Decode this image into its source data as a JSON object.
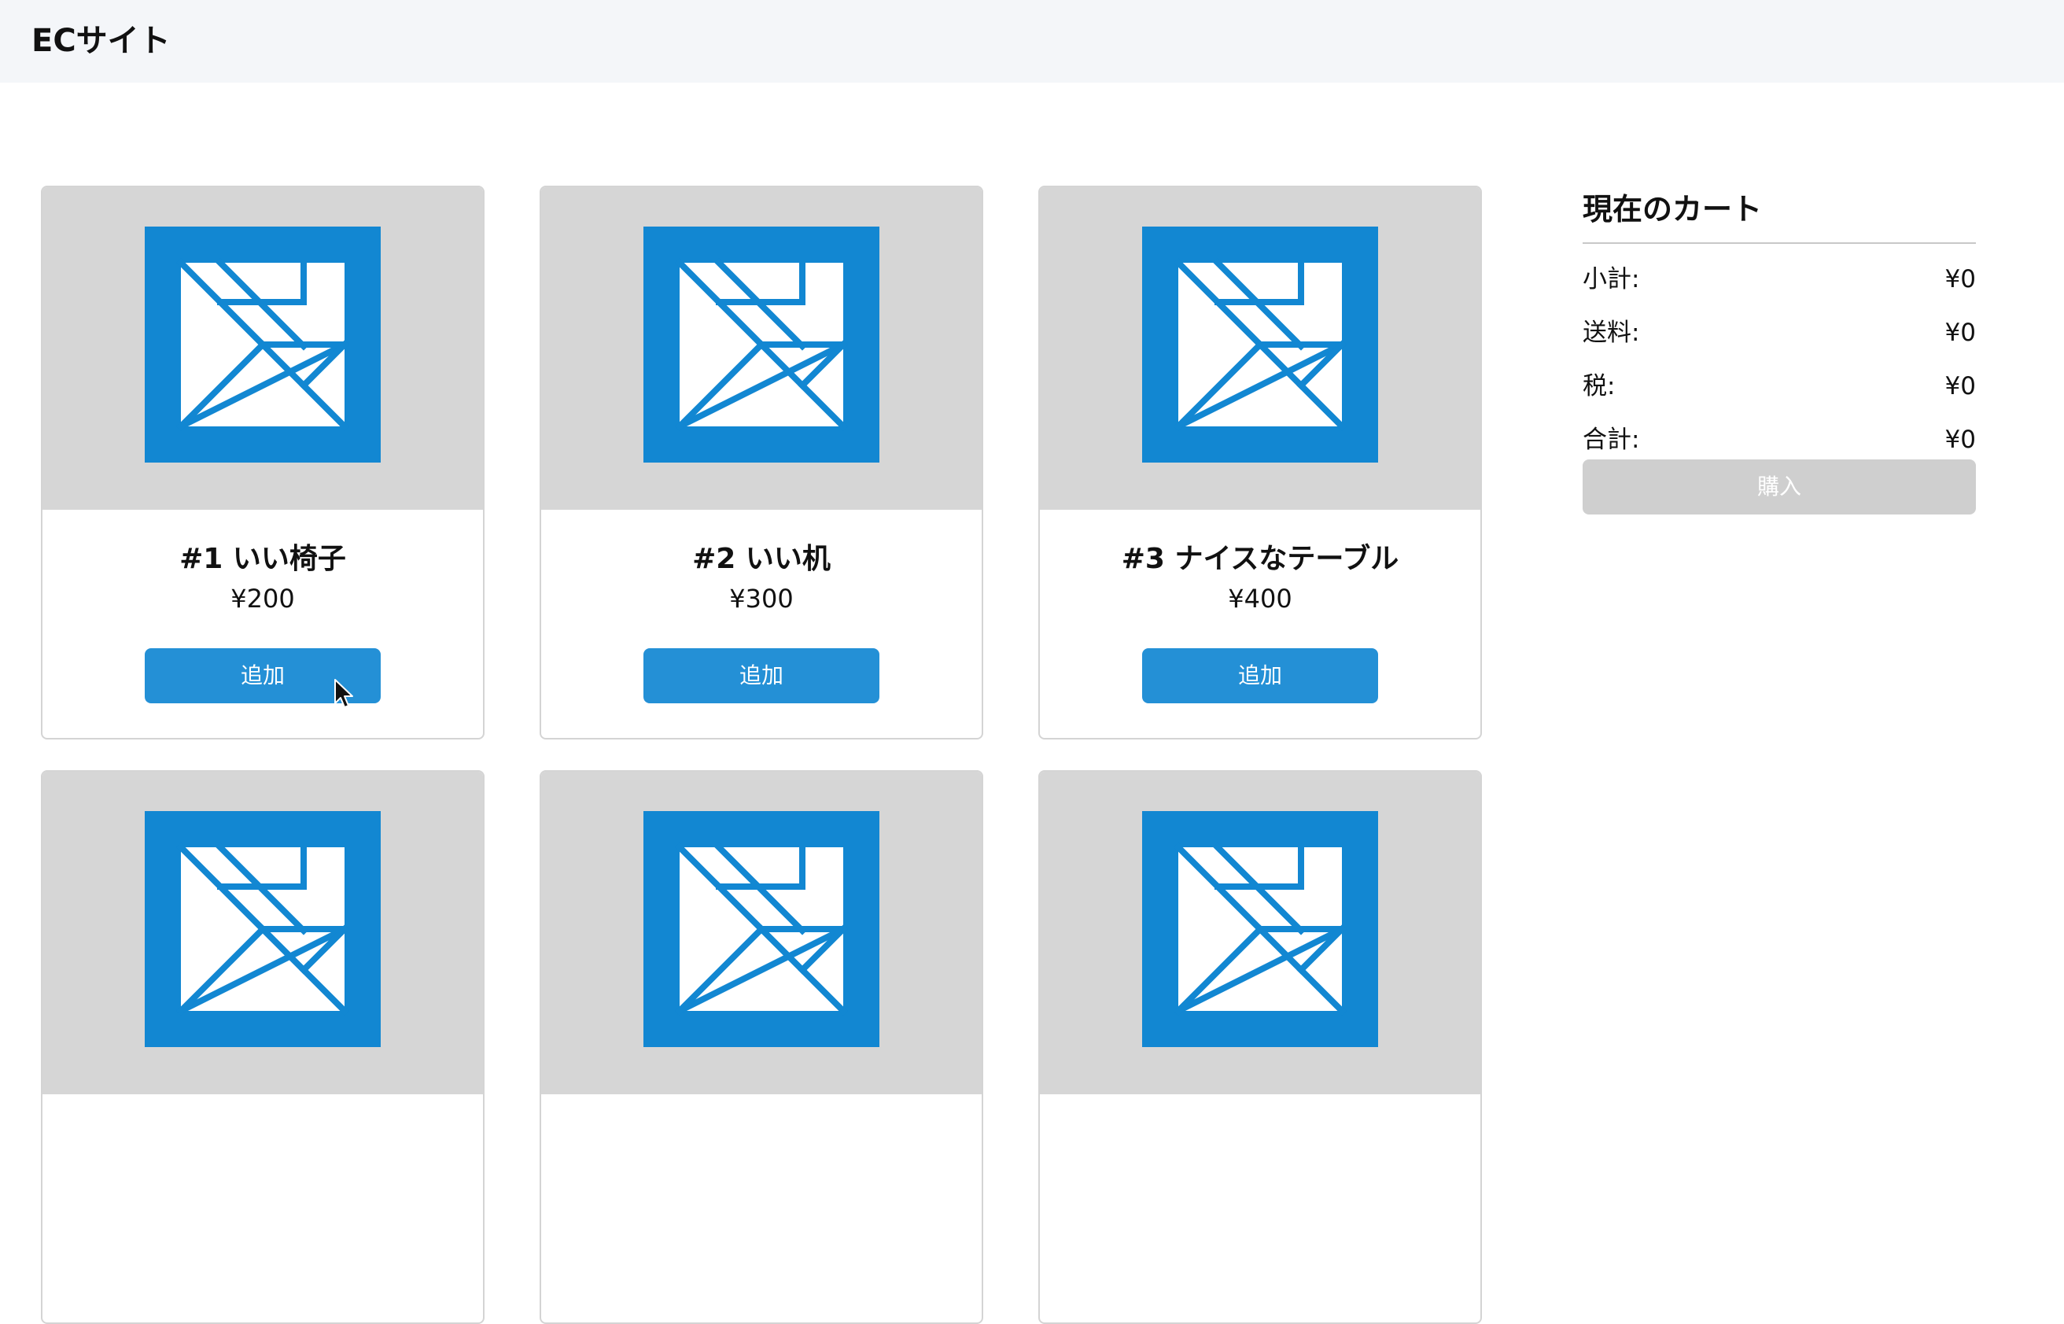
{
  "header": {
    "title": "ECサイト"
  },
  "products": [
    {
      "name": "#1 いい椅子",
      "price": "¥200",
      "add_label": "追加"
    },
    {
      "name": "#2 いい机",
      "price": "¥300",
      "add_label": "追加"
    },
    {
      "name": "#3 ナイスなテーブル",
      "price": "¥400",
      "add_label": "追加"
    },
    {
      "name": "",
      "price": "",
      "add_label": ""
    },
    {
      "name": "",
      "price": "",
      "add_label": ""
    },
    {
      "name": "",
      "price": "",
      "add_label": ""
    }
  ],
  "cart": {
    "title": "現在のカート",
    "subtotal_label": "小計:",
    "subtotal": "¥0",
    "shipping_label": "送料:",
    "shipping": "¥0",
    "tax_label": "税:",
    "tax": "¥0",
    "total_label": "合計:",
    "total": "¥0",
    "buy_label": "購入"
  },
  "icons": {
    "product_image": "tangram-placeholder-icon",
    "pointer": "mouse-cursor-icon"
  },
  "colors": {
    "accent": "#2490d6",
    "image_blue": "#1287d2",
    "image_bg": "#d6d6d6",
    "disabled": "#cfcfcf",
    "header_bg": "#f4f6f9"
  }
}
